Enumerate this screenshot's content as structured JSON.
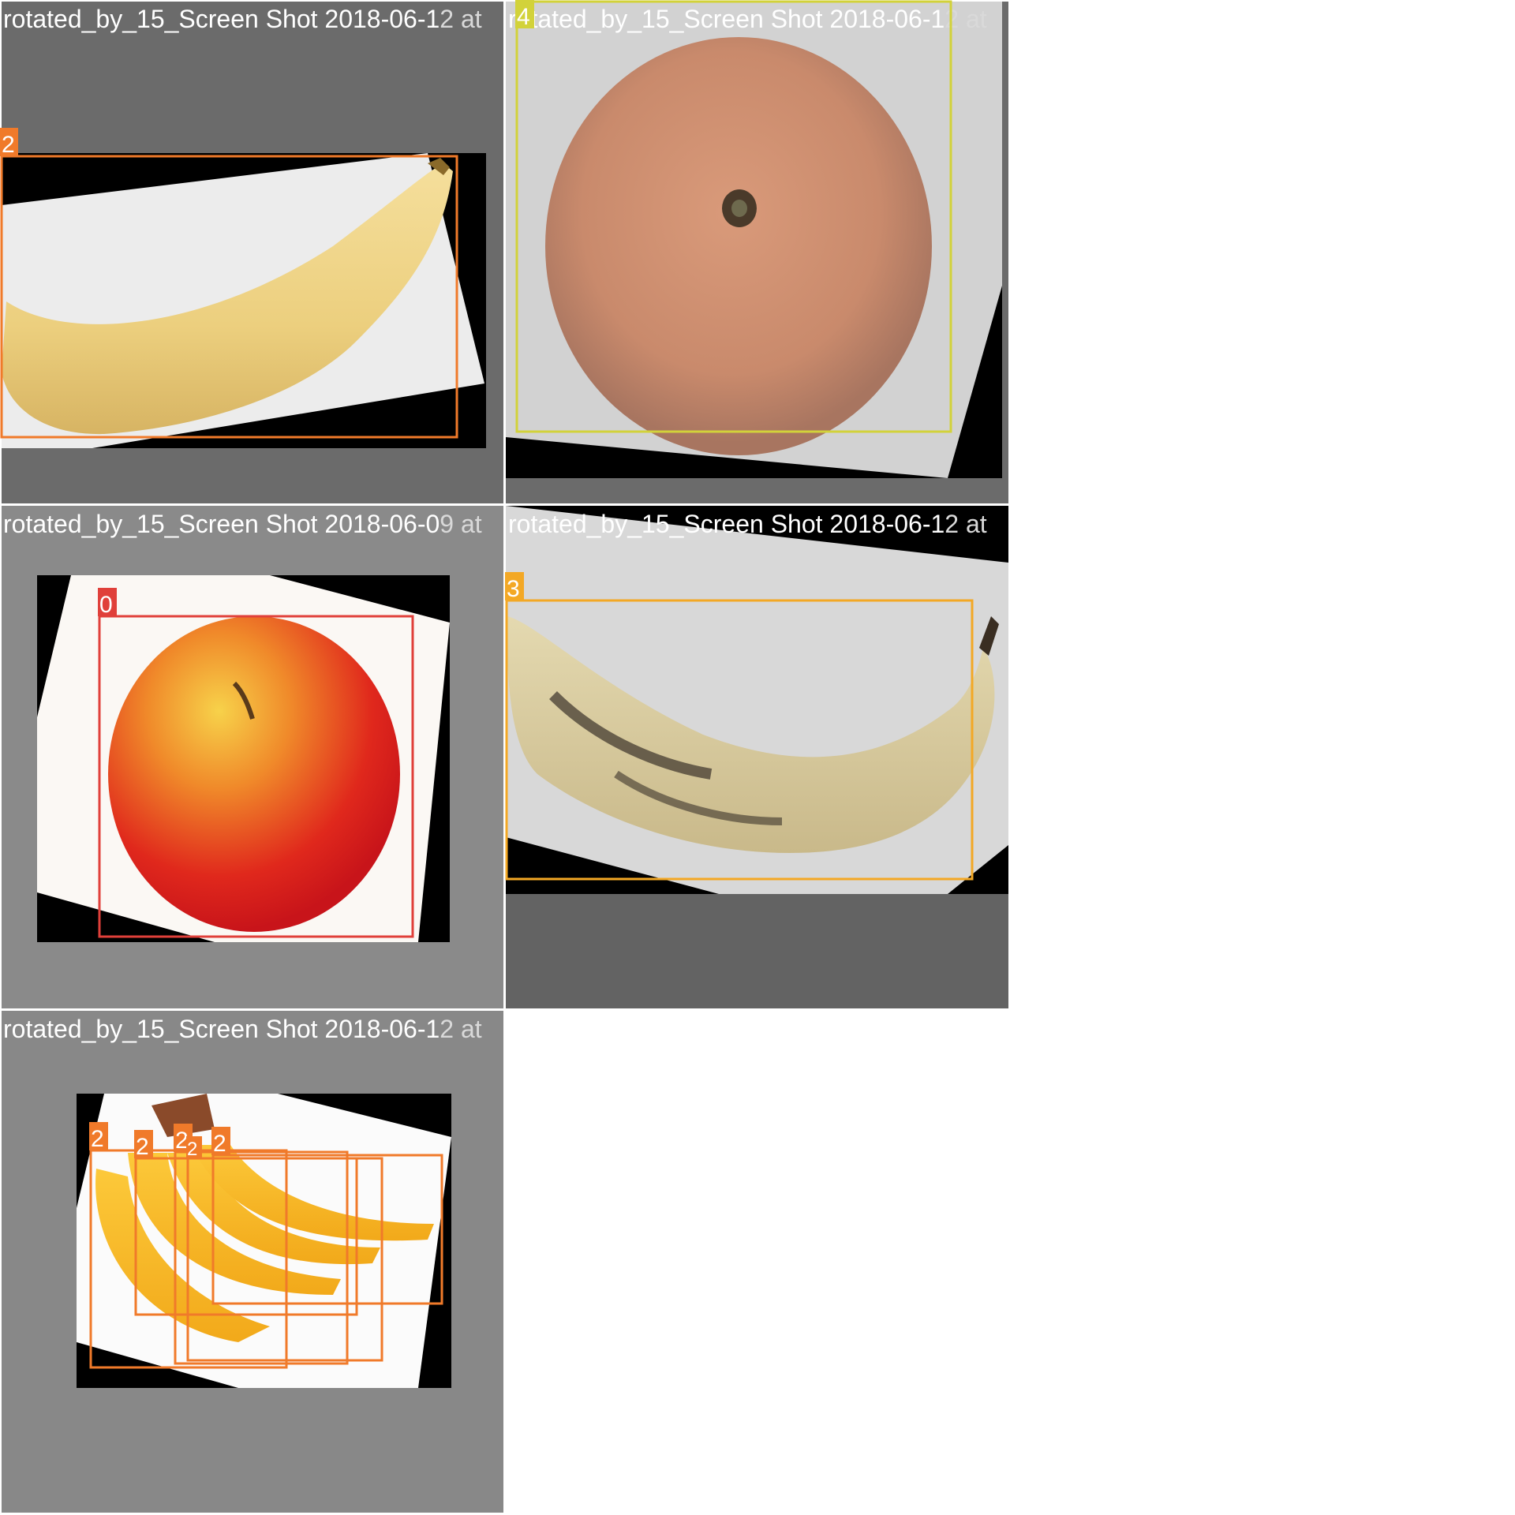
{
  "captions": [
    {
      "visible": "rotated_by_15_Screen Shot 2018-06-1",
      "faded": "2 at"
    },
    {
      "visible": "rotated_by_15_Screen Shot 2018-06-1",
      "faded": "2 at"
    },
    {
      "visible": "rotated_by_15_Screen Shot 2018-06-0",
      "faded": "9 at"
    },
    {
      "visible": "rotated_by_15_Screen Shot 2018-06-1",
      "faded": "2 at"
    },
    {
      "visible": "rotated_by_15_Screen Shot 2018-06-1",
      "faded": "2 at"
    }
  ],
  "labels": {
    "tile1": [
      "2"
    ],
    "tile2": [
      "4"
    ],
    "tile3": [
      "0"
    ],
    "tile4": [
      "3"
    ],
    "tile5": [
      "2",
      "2",
      "2",
      "2",
      "2"
    ]
  },
  "colors": {
    "class0": "#e0403a",
    "class2": "#f07a2a",
    "class3": "#f3a825",
    "class4": "#d2d23a",
    "tile_bg_dark": "#6b6b6b",
    "tile_bg_mid": "#8a8a8a"
  }
}
